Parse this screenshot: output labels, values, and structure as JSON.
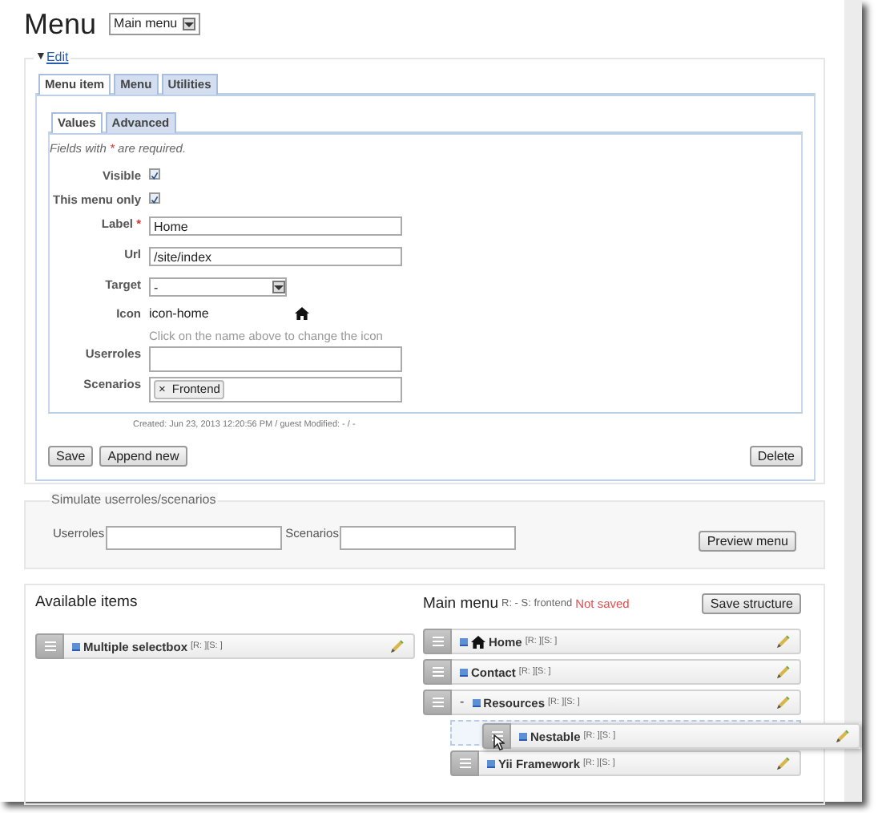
{
  "header": {
    "title": "Menu",
    "menu_select": "Main menu"
  },
  "edit": {
    "toggle": "▼",
    "legend": "Edit",
    "tabs": [
      {
        "label": "Menu item",
        "selected": true
      },
      {
        "label": "Menu",
        "selected": false
      },
      {
        "label": "Utilities",
        "selected": false
      }
    ],
    "subtabs": [
      {
        "label": "Values",
        "selected": true
      },
      {
        "label": "Advanced",
        "selected": false
      }
    ],
    "required_note": {
      "before": "Fields with",
      "mark": "*",
      "after": "are required."
    },
    "fields": [
      {
        "kind": "checkbox",
        "label": "Visible",
        "checked": true
      },
      {
        "kind": "checkbox",
        "label": "This menu only",
        "checked": true
      },
      {
        "kind": "text",
        "label": "Label",
        "required_mark": "*",
        "value": "Home"
      },
      {
        "kind": "text",
        "label": "Url",
        "value": "/site/index"
      },
      {
        "kind": "select",
        "label": "Target",
        "value": "-"
      },
      {
        "kind": "icon",
        "label": "Icon",
        "value": "icon-home",
        "hint": "Click on the name above to change the icon"
      },
      {
        "kind": "tags",
        "label": "Userroles"
      },
      {
        "kind": "tags",
        "label": "Scenarios",
        "tags": [
          {
            "remove": "×",
            "label": "Frontend"
          }
        ]
      }
    ],
    "meta": "Created: Jun 23, 2013 12:20:56 PM / guest Modified: - / -",
    "buttons_left": [
      "Save",
      "Append new"
    ],
    "buttons_right": [
      "Delete"
    ]
  },
  "simulate": {
    "legend": "Simulate userroles/scenarios",
    "fields": [
      {
        "label": "Userroles"
      },
      {
        "label": "Scenarios"
      }
    ],
    "button": "Preview menu"
  },
  "structure": {
    "available": {
      "title": "Available items",
      "items": [
        {
          "label": "Multiple selectbox",
          "meta": "[R: ][S: ]"
        }
      ]
    },
    "main": {
      "title": "Main menu",
      "info": "R: - S: frontend",
      "status": "Not saved",
      "button": "Save structure",
      "items": [
        {
          "label": "Home",
          "meta": "[R: ][S: ]",
          "home_icon": true
        },
        {
          "label": "Contact",
          "meta": "[R: ][S: ]"
        },
        {
          "label": "Resources",
          "meta": "[R: ][S: ]",
          "collapse": "-",
          "expanded": true,
          "children": [
            {
              "label": "Nestable",
              "meta": "[R: ][S: ]",
              "dragging": true
            },
            {
              "label": "Yii Framework",
              "meta": "[R: ][S: ]"
            }
          ]
        }
      ]
    }
  }
}
